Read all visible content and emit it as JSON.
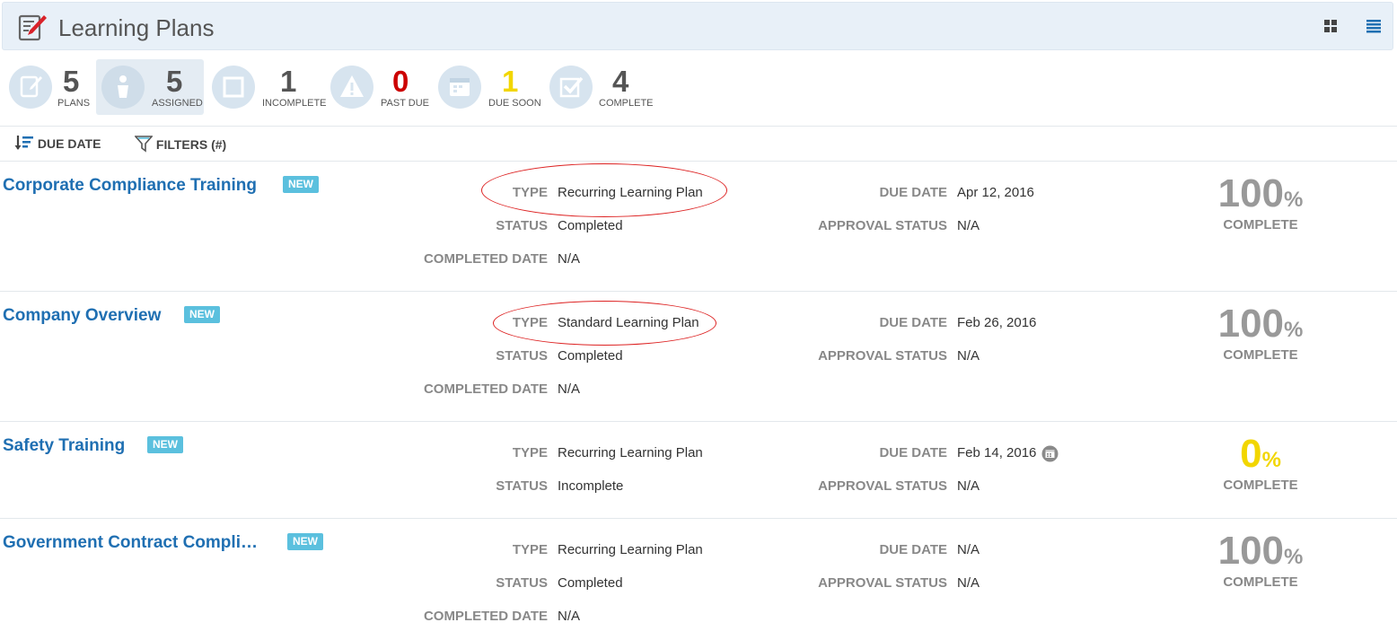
{
  "header": {
    "title": "Learning Plans"
  },
  "stats": [
    {
      "value": "5",
      "label": "PLANS",
      "icon": "plans-icon",
      "color": "#555555"
    },
    {
      "value": "5",
      "label": "ASSIGNED",
      "icon": "user-icon",
      "color": "#555555"
    },
    {
      "value": "1",
      "label": "INCOMPLETE",
      "icon": "square-icon",
      "color": "#555555"
    },
    {
      "value": "0",
      "label": "PAST DUE",
      "icon": "warning-icon",
      "color": "#cc0000"
    },
    {
      "value": "1",
      "label": "DUE SOON",
      "icon": "calendar-icon",
      "color": "#f2d600"
    },
    {
      "value": "4",
      "label": "COMPLETE",
      "icon": "checkbox-icon",
      "color": "#555555"
    }
  ],
  "toolbar": {
    "sort_label": "DUE DATE",
    "filter_label": "FILTERS (#)"
  },
  "labels": {
    "type": "TYPE",
    "status": "STATUS",
    "completed_date": "COMPLETED DATE",
    "due_date": "DUE DATE",
    "approval_status": "APPROVAL STATUS",
    "complete": "COMPLETE",
    "new": "NEW",
    "percent_sign": "%"
  },
  "plans": [
    {
      "title": "Corporate Compliance Training",
      "type": "Recurring Learning Plan",
      "status": "Completed",
      "completed_date": "N/A",
      "due_date": "Apr 12, 2016",
      "approval_status": "N/A",
      "percent": "100"
    },
    {
      "title": "Company Overview",
      "type": "Standard Learning Plan",
      "status": "Completed",
      "completed_date": "N/A",
      "due_date": "Feb 26, 2016",
      "approval_status": "N/A",
      "percent": "100"
    },
    {
      "title": "Safety Training",
      "type": "Recurring Learning Plan",
      "status": "Incomplete",
      "due_date": "Feb 14, 2016",
      "approval_status": "N/A",
      "percent": "0"
    },
    {
      "title": "Government Contract Compli…",
      "type": "Recurring Learning Plan",
      "status": "Completed",
      "completed_date": "N/A",
      "due_date": "N/A",
      "approval_status": "N/A",
      "percent": "100"
    }
  ],
  "colors": {
    "accent": "#1f6fb2",
    "badge": "#5bc0de",
    "annotation": "#dd2222",
    "due_soon": "#f2d600"
  }
}
